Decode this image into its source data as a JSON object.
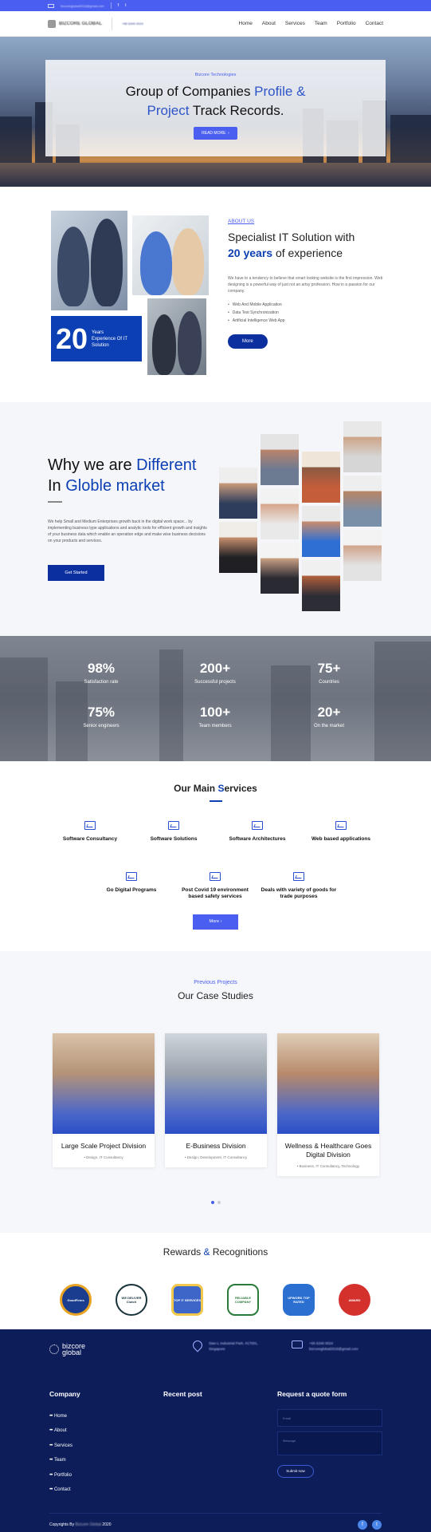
{
  "topbar": {
    "email": "bizcoreglobal2016@gmail.com",
    "facebook_icon": "f",
    "twitter_icon": "t"
  },
  "header": {
    "logo": "BIZCORE GLOBAL",
    "phone": "+65 6340 0024",
    "nav": [
      "Home",
      "About",
      "Services",
      "Team",
      "Portfolio",
      "Contact"
    ]
  },
  "hero": {
    "tag": "Bizcore Technologies",
    "title_a": "Group of Companies ",
    "title_b": "Profile &",
    "title_c": "Project",
    "title_d": " Track Records.",
    "button": "READ MORE"
  },
  "about": {
    "years_num": "20",
    "years_text_1": "Years",
    "years_text_2": "Experience Of IT",
    "years_text_3": "Solution",
    "label": "ABOUT US",
    "heading_a": "Specialist IT Solution with",
    "heading_b": "20 years",
    "heading_c": " of experience",
    "paragraph": "We have to a tendency to believe that smart looking website is the first impression. Web designing is a powerful way of just not an artsy profession. How in a passion for our company.",
    "list": [
      "Web And Mobile Application",
      "Data Test Synchronization",
      "Artificial Intelligence Web App"
    ],
    "button": "More"
  },
  "why": {
    "heading_a": "Why we are ",
    "heading_b": "Different",
    "heading_c": "In ",
    "heading_d": "Globle market",
    "paragraph": "We help Small and Medium Enterprises growth back in the digital work space... by implementing business type applications and analytic tools for efficient growth and insights of your business data which enable an operation edge and make wise business decisions on your products and services.",
    "button": "Get Started"
  },
  "stats": [
    {
      "value": "98%",
      "label": "Satisfaction rate"
    },
    {
      "value": "200+",
      "label": "Successful projects"
    },
    {
      "value": "75+",
      "label": "Countries"
    },
    {
      "value": "75%",
      "label": "Senior engineers"
    },
    {
      "value": "100+",
      "label": "Team members"
    },
    {
      "value": "20+",
      "label": "On the market"
    }
  ],
  "services": {
    "heading_a": "Our Main ",
    "heading_b": "S",
    "heading_c": "ervices",
    "items": [
      "Software Consultancy",
      "Software Solutions",
      "Software Architectures",
      "Web based applications",
      "Go Digital Programs",
      "Post Covid 19 environment based safety services",
      "Deals with variety of goods for trade purposes"
    ],
    "button": "More ›"
  },
  "cases": {
    "label": "Previous Projects",
    "heading": "Our Case Studies",
    "items": [
      {
        "title": "Large Scale Project Division",
        "sub": "• Design, IT Consultancy"
      },
      {
        "title": "E-Business Division",
        "sub": "• Design, Development, IT Consultancy"
      },
      {
        "title": "Wellness & Healthcare Goes Digital Division",
        "sub": "• Business, IT Consultancy, Technology"
      }
    ]
  },
  "rewards": {
    "heading_a": "Rewards ",
    "heading_b": "&",
    "heading_c": " Recognitions",
    "badges": [
      "GoodFirms",
      "WE DELIVER Clutch",
      "TOP IT SERVICES",
      "RELIABLE COMPANY",
      "UPWORK TOP RATED",
      "AWARD"
    ]
  },
  "footer": {
    "logo_1": "bizcore",
    "logo_2": "global",
    "address": "Stan-L Industrial Park, #17001, Singapore",
    "phone": "+65 6340 0024",
    "email": "bizcoreglobal2016@gmail.com",
    "col_company": "Company",
    "col_recent": "Recent post",
    "col_quote": "Request a quote form",
    "links": [
      "Home",
      "About",
      "Services",
      "Team",
      "Portfolio",
      "Contact"
    ],
    "placeholder_email": "Email",
    "placeholder_message": "Message",
    "submit": "Submit now",
    "copyright_a": "Copyrights By ",
    "copyright_b": "Bizcore Global",
    "copyright_c": " 2020"
  }
}
